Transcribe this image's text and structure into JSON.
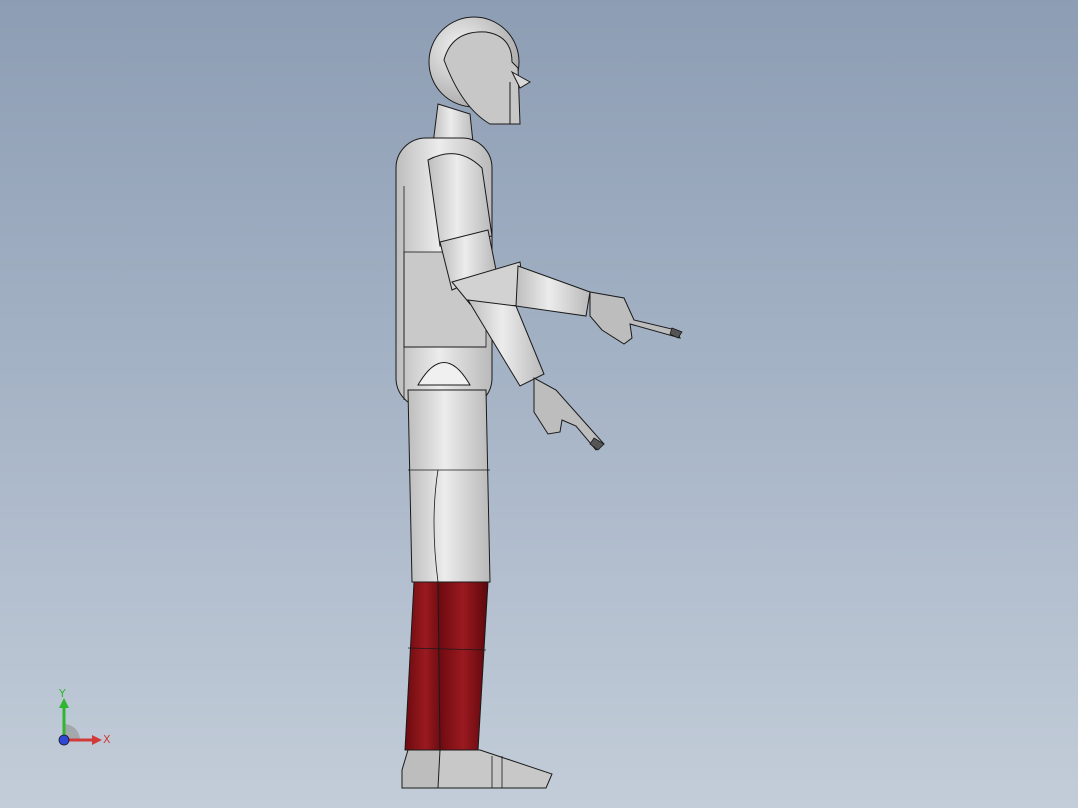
{
  "viewport": {
    "background_top": "#8d9db3",
    "background_bottom": "#c3cdd9"
  },
  "model": {
    "name_icon": "humanoid-robot-model",
    "colors": {
      "body": "#d9d9d9",
      "body_shadow": "#b8b8b8",
      "lower_leg": "#7a0d12",
      "lower_leg_highlight": "#9a1a20",
      "feet": "#bdbdbd",
      "outline": "#1a1a1a"
    }
  },
  "triad": {
    "icon": "axis-triad-icon",
    "y_label": "Y",
    "x_label": "X",
    "colors": {
      "y": "#2fb52f",
      "x": "#d23a3a",
      "z": "#2f49d6"
    }
  }
}
